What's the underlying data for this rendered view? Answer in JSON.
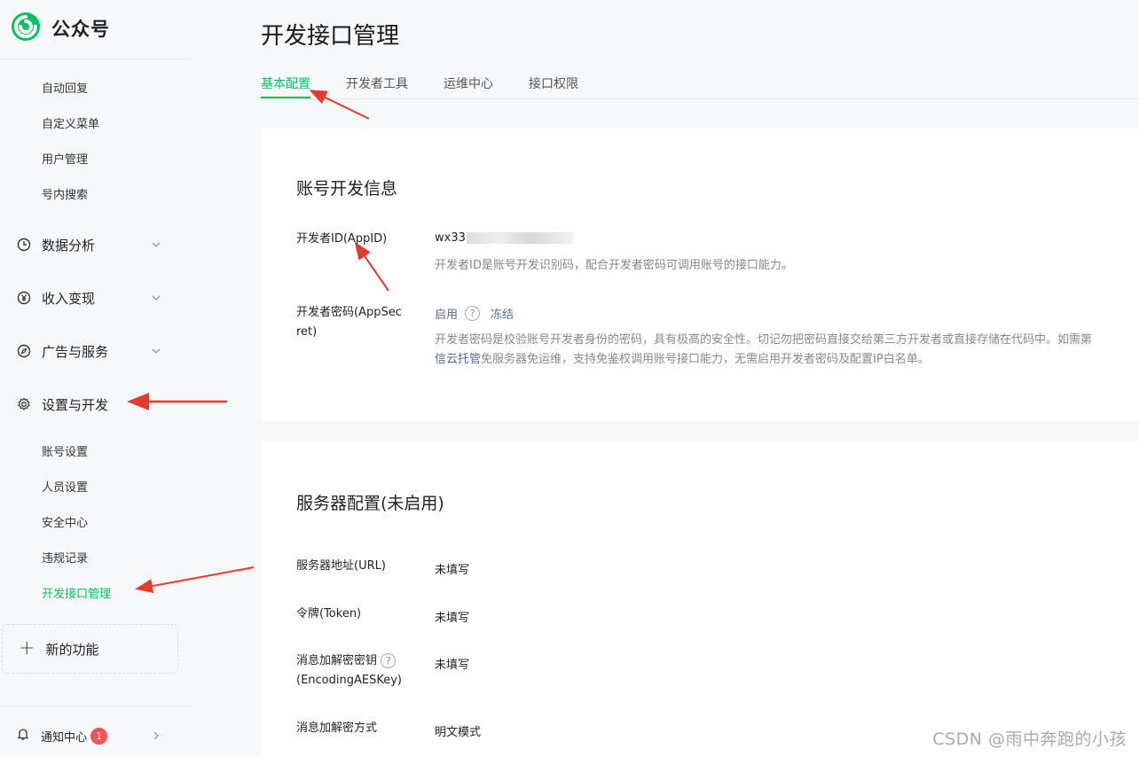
{
  "brand": {
    "name": "公众号",
    "accent": "#07c160"
  },
  "sidebar": {
    "top_items": [
      "自动回复",
      "自定义菜单",
      "用户管理",
      "号内搜索"
    ],
    "groups": [
      {
        "label": "数据分析",
        "icon": "clock-icon"
      },
      {
        "label": "收入变现",
        "icon": "yen-icon"
      },
      {
        "label": "广告与服务",
        "icon": "compass-icon"
      },
      {
        "label": "设置与开发",
        "icon": "gear-icon"
      }
    ],
    "settings_items": [
      "账号设置",
      "人员设置",
      "安全中心",
      "违规记录",
      "开发接口管理"
    ],
    "active_item": "开发接口管理",
    "new_feature_label": "新的功能",
    "notify_label": "通知中心",
    "notify_count": "1"
  },
  "page": {
    "title": "开发接口管理",
    "tabs": [
      "基本配置",
      "开发者工具",
      "运维中心",
      "接口权限"
    ],
    "active_tab": "基本配置"
  },
  "account_info": {
    "title": "账号开发信息",
    "appid_label": "开发者ID(AppID)",
    "appid_value": "wx33",
    "appid_desc": "开发者ID是账号开发识别码，配合开发者密码可调用账号的接口能力。",
    "secret_label_1": "开发者密码(AppSec",
    "secret_label_2": "ret)",
    "secret_action_enable": "启用",
    "secret_action_freeze": "冻结",
    "secret_desc_1": "开发者密码是校验账号开发者身份的密码，具有极高的安全性。切记勿把密码直接交给第三方开发者或直接存储在代码中。如需第",
    "secret_desc_link": "信云托管",
    "secret_desc_2": "免服务器免运维，支持免鉴权调用账号接口能力，无需启用开发者密码及配置IP白名单。"
  },
  "server_config": {
    "title": "服务器配置(未启用)",
    "rows": [
      {
        "label": "服务器地址(URL)",
        "value": "未填写"
      },
      {
        "label": "令牌(Token)",
        "value": "未填写"
      },
      {
        "label": "消息加解密密钥",
        "label2": "(EncodingAESKey)",
        "value": "未填写"
      },
      {
        "label": "消息加解密方式",
        "value": "明文模式"
      }
    ]
  },
  "watermark": "CSDN @雨中奔跑的小孩"
}
